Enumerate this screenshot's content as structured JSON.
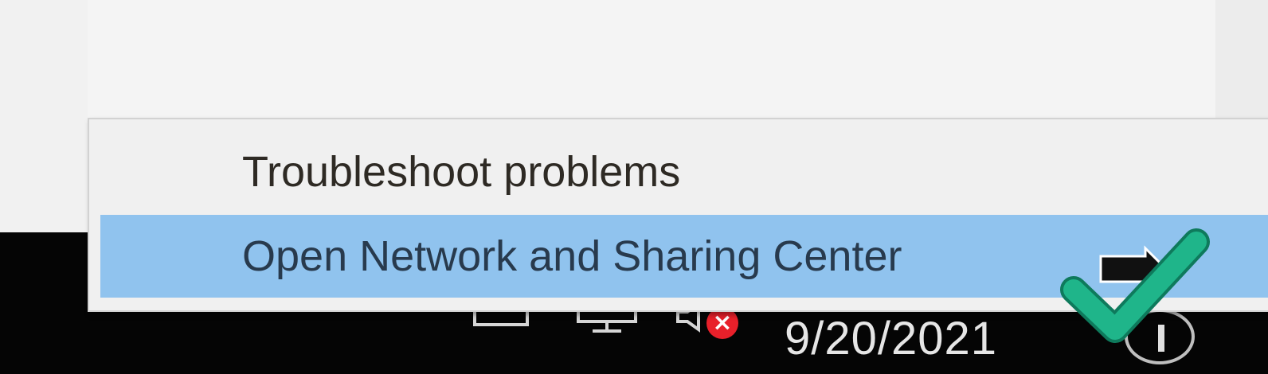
{
  "context_menu": {
    "items": [
      {
        "label": "Troubleshoot problems",
        "highlighted": false
      },
      {
        "label": "Open Network and Sharing Center",
        "highlighted": true
      }
    ]
  },
  "taskbar": {
    "date": "9/20/2021",
    "tray_icons": [
      "monitor-icon",
      "network-icon",
      "volume-muted-icon",
      "notification-icon"
    ]
  },
  "overlay": {
    "check_icon": "check-icon",
    "check_color": "#1fb58a"
  },
  "colors": {
    "menu_highlight": "#90c3ee",
    "menu_background": "#f0f0f0",
    "taskbar": "#050505",
    "error_badge": "#e8202a"
  }
}
